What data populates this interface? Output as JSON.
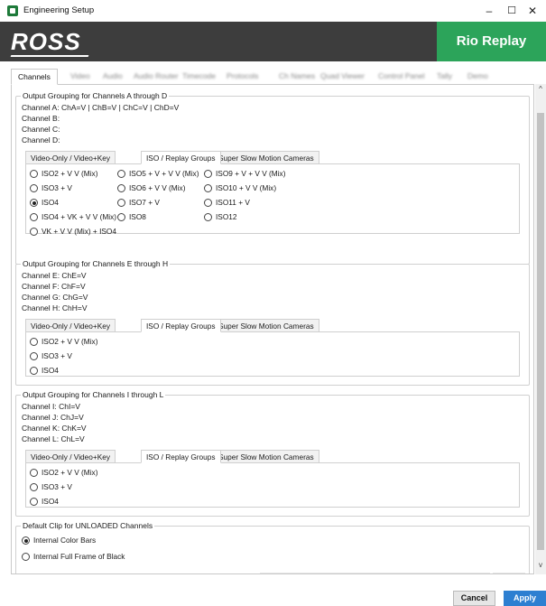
{
  "window": {
    "title": "Engineering Setup",
    "minimize": "–",
    "maximize": "☐",
    "close": "✕"
  },
  "banner": {
    "logo": "ROSS",
    "product": "Rio Replay"
  },
  "tabs": [
    {
      "label": "Channels",
      "blurred": false
    },
    {
      "label": "Video",
      "blurred": true
    },
    {
      "label": "Audio",
      "blurred": true
    },
    {
      "label": "Audio Router",
      "blurred": true
    },
    {
      "label": "Timecode",
      "blurred": true
    },
    {
      "label": "Protocols",
      "blurred": true
    },
    {
      "label": "Ch Names",
      "blurred": true
    },
    {
      "label": "Quad Viewer",
      "blurred": true
    },
    {
      "label": "Control Panel",
      "blurred": true
    },
    {
      "label": "Tally",
      "blurred": true
    },
    {
      "label": "Demo",
      "blurred": true
    }
  ],
  "groups": [
    {
      "title": "Output Grouping for Channels A through D",
      "lines": [
        "Channel A: ChA=V | ChB=V | ChC=V | ChD=V",
        "Channel B:",
        "Channel C:",
        "Channel D:"
      ],
      "subtabs": [
        "Video-Only / Video+Key",
        "ISO / Replay Groups",
        "Super Slow Motion Cameras"
      ],
      "active_subtab": 1,
      "options": [
        "ISO2 + V V (Mix)",
        "ISO3 + V",
        "ISO4",
        "ISO4 + VK + V V (Mix)",
        "VK + V V (Mix) + ISO4",
        "ISO5 + V + V V (Mix)",
        "ISO6 + V V (Mix)",
        "ISO7 + V",
        "ISO8",
        "ISO9 + V + V V (Mix)",
        "ISO10 + V V (Mix)",
        "ISO11 + V",
        "ISO12"
      ],
      "selected": "ISO4"
    },
    {
      "title": "Output Grouping for Channels E through H",
      "lines": [
        "Channel E: ChE=V",
        "Channel F: ChF=V",
        "Channel G: ChG=V",
        "Channel H: ChH=V"
      ],
      "subtabs": [
        "Video-Only / Video+Key",
        "ISO / Replay Groups",
        "Super Slow Motion Cameras"
      ],
      "active_subtab": 1,
      "options": [
        "ISO2 + V V (Mix)",
        "ISO3 + V",
        "ISO4"
      ],
      "selected": ""
    },
    {
      "title": "Output Grouping for Channels I through L",
      "lines": [
        "Channel I: ChI=V",
        "Channel J: ChJ=V",
        "Channel K: ChK=V",
        "Channel L: ChL=V"
      ],
      "subtabs": [
        "Video-Only / Video+Key",
        "ISO / Replay Groups",
        "Super Slow Motion Cameras"
      ],
      "active_subtab": 1,
      "options": [
        "ISO2 + V V (Mix)",
        "ISO3 + V",
        "ISO4"
      ],
      "selected": ""
    }
  ],
  "default_clip": {
    "title": "Default Clip for UNLOADED Channels",
    "options": [
      "Internal Color Bars",
      "Internal Full Frame of Black"
    ],
    "selected": "Internal Color Bars"
  },
  "scrollbar": {
    "up": "^",
    "down": "v"
  },
  "buttons": {
    "cancel": "Cancel",
    "apply": "Apply"
  }
}
